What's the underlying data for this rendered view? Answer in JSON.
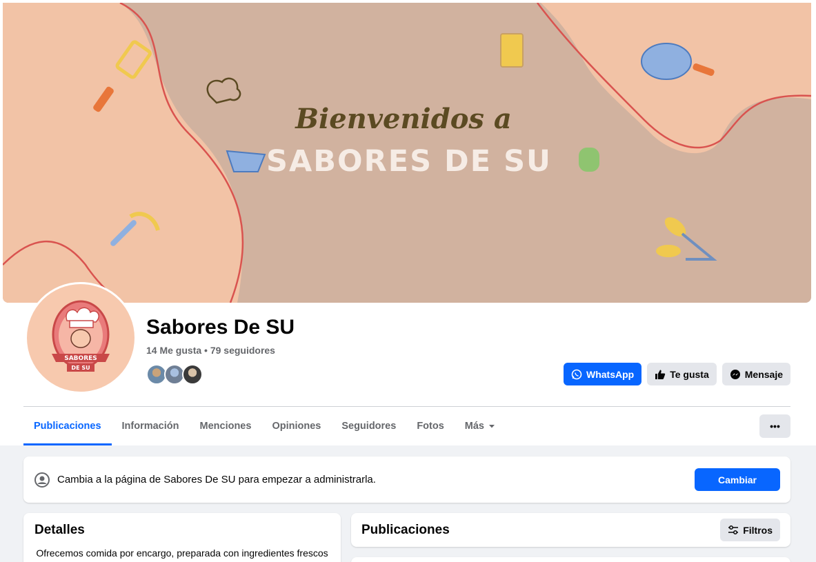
{
  "cover": {
    "line1": "Bienvenidos a",
    "line2": "SABORES DE SU"
  },
  "profile": {
    "name": "Sabores De SU",
    "stats": "14 Me gusta • 79 seguidores",
    "logo_top": "SABORES",
    "logo_bottom": "DE SU"
  },
  "actions": {
    "whatsapp": "WhatsApp",
    "like": "Te gusta",
    "message": "Mensaje"
  },
  "tabs": [
    {
      "label": "Publicaciones",
      "active": true
    },
    {
      "label": "Información"
    },
    {
      "label": "Menciones"
    },
    {
      "label": "Opiniones"
    },
    {
      "label": "Seguidores"
    },
    {
      "label": "Fotos"
    },
    {
      "label": "Más"
    }
  ],
  "more_options": "•••",
  "banner": {
    "text": "Cambia a la página de Sabores De SU para empezar a administrarla.",
    "button": "Cambiar"
  },
  "details": {
    "title": "Detalles",
    "text": "Ofrecemos comida por encargo, preparada con ingredientes frescos"
  },
  "posts": {
    "title": "Publicaciones",
    "filters": "Filtros"
  },
  "colors": {
    "accent": "#0866ff",
    "cover_bg": "#d1b29f",
    "cover_blob": "#f2c3a6",
    "cover_line": "#d9534f",
    "text_secondary": "#65676b"
  }
}
